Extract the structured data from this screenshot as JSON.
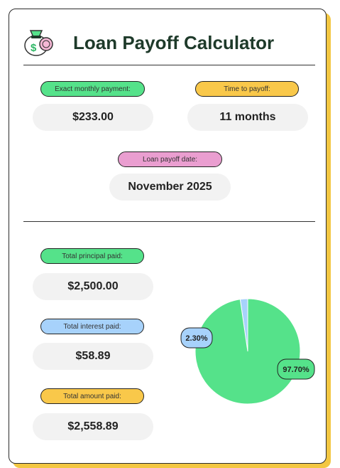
{
  "title": "Loan Payoff Calculator",
  "summary": {
    "monthly_payment_label": "Exact monthly payment:",
    "monthly_payment_value": "$233.00",
    "time_to_payoff_label": "Time to payoff:",
    "time_to_payoff_value": "11 months",
    "payoff_date_label": "Loan payoff date:",
    "payoff_date_value": "November 2025"
  },
  "totals": {
    "principal_label": "Total principal paid:",
    "principal_value": "$2,500.00",
    "interest_label": "Total interest paid:",
    "interest_value": "$58.89",
    "amount_label": "Total amount paid:",
    "amount_value": "$2,558.89"
  },
  "colors": {
    "principal": "#55e28a",
    "interest": "#a7d2fb",
    "amount": "#f9c84a",
    "payoff_date": "#ea9ed0",
    "accent_shadow": "#f3c742"
  },
  "icons": {
    "logo": "money-bag-icon"
  },
  "chart_data": {
    "type": "pie",
    "slices": [
      {
        "name": "Total interest paid",
        "value": 2.3,
        "label": "2.30%",
        "color": "#a7d2fb"
      },
      {
        "name": "Total principal paid",
        "value": 97.7,
        "label": "97.70%",
        "color": "#55e28a"
      }
    ]
  }
}
